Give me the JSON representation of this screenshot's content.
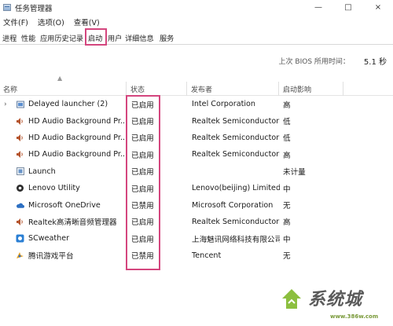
{
  "window": {
    "title": "任务管理器",
    "minimize": "—",
    "maximize": "□",
    "close": "×"
  },
  "menu": {
    "items": [
      "文件(F)",
      "选项(O)",
      "查看(V)"
    ]
  },
  "tabs": {
    "items": [
      "进程",
      "性能",
      "应用历史记录",
      "启动",
      "用户",
      "详细信息",
      "服务"
    ],
    "active": "启动"
  },
  "bios": {
    "label": "上次 BIOS 所用时间：",
    "value": "5.1 秒"
  },
  "columns": {
    "name": "名称",
    "status": "状态",
    "publisher": "发布者",
    "impact": "启动影响"
  },
  "rows": [
    {
      "expander": "›",
      "icon": "launcher-icon",
      "name": "Delayed launcher (2)",
      "status": "已启用",
      "publisher": "Intel Corporation",
      "impact": "高"
    },
    {
      "expander": "",
      "icon": "speaker-icon",
      "name": "HD Audio Background Pr...",
      "status": "已启用",
      "publisher": "Realtek Semiconductor",
      "impact": "低"
    },
    {
      "expander": "",
      "icon": "speaker-icon",
      "name": "HD Audio Background Pr...",
      "status": "已启用",
      "publisher": "Realtek Semiconductor",
      "impact": "低"
    },
    {
      "expander": "",
      "icon": "speaker-icon",
      "name": "HD Audio Background Pr...",
      "status": "已启用",
      "publisher": "Realtek Semiconductor",
      "impact": "高"
    },
    {
      "expander": "",
      "icon": "app-window-icon",
      "name": "Launch",
      "status": "已启用",
      "publisher": "",
      "impact": "未计量"
    },
    {
      "expander": "",
      "icon": "lenovo-gear-icon",
      "name": "Lenovo Utility",
      "status": "已启用",
      "publisher": "Lenovo(beijing) Limited",
      "impact": "中"
    },
    {
      "expander": "",
      "icon": "cloud-icon",
      "name": "Microsoft OneDrive",
      "status": "已禁用",
      "publisher": "Microsoft Corporation",
      "impact": "无"
    },
    {
      "expander": "",
      "icon": "speaker-icon",
      "name": "Realtek高清晰音频管理器",
      "status": "已启用",
      "publisher": "Realtek Semiconductor",
      "impact": "高"
    },
    {
      "expander": "",
      "icon": "weather-icon",
      "name": "SCweather",
      "status": "已启用",
      "publisher": "上海魅讯网络科技有限公司",
      "impact": "中"
    },
    {
      "expander": "",
      "icon": "game-controller-icon",
      "name": "腾讯游戏平台",
      "status": "已禁用",
      "publisher": "Tencent",
      "impact": "无"
    }
  ],
  "watermark": {
    "text": "系统城",
    "url": "www.386w.com"
  },
  "colors": {
    "highlight": "#d4467e",
    "header_text": "#4a4a4a"
  }
}
